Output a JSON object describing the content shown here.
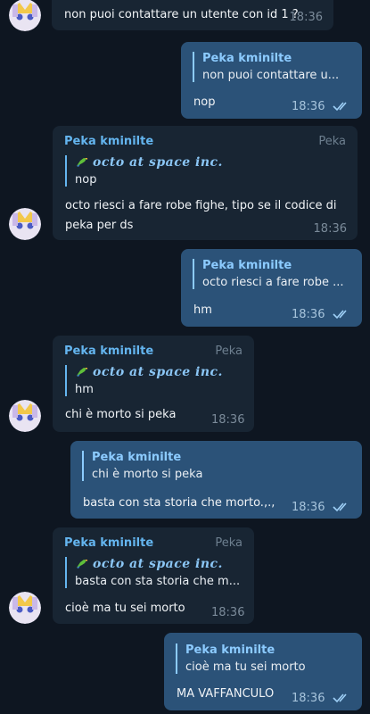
{
  "messages": {
    "m1": {
      "text": "non puoi contattare un utente con id 1 ?",
      "time": "18:36"
    },
    "m2": {
      "quote_name": "Peka kminilte",
      "quote_text": "non puoi contattare u...",
      "text": "nop",
      "time": "18:36"
    },
    "m3": {
      "sender": "Peka kminilte",
      "tag": "Peka",
      "quote_name": "octo at space inc.",
      "quote_text": "nop",
      "text_line1": "octo riesci a fare robe fighe, tipo se il codice di",
      "text_line2": "peka per ds",
      "time": "18:36"
    },
    "m4": {
      "quote_name": "Peka kminilte",
      "quote_text": "octo riesci a fare robe ...",
      "text": "hm",
      "time": "18:36"
    },
    "m5": {
      "sender": "Peka kminilte",
      "tag": "Peka",
      "quote_name": "octo at space inc.",
      "quote_text": "hm",
      "text": "chi è morto si peka",
      "time": "18:36"
    },
    "m6": {
      "quote_name": "Peka kminilte",
      "quote_text": "chi è morto si peka",
      "text": "basta con sta storia che morto.,.,",
      "time": "18:36"
    },
    "m7": {
      "sender": "Peka kminilte",
      "tag": "Peka",
      "quote_name": "octo at space inc.",
      "quote_text": "basta con sta storia che m...",
      "text": "cioè ma tu sei morto",
      "time": "18:36"
    },
    "m8": {
      "quote_name": "Peka kminilte",
      "quote_text": "cioè ma tu sei morto",
      "text": "MA VAFFANCULO",
      "time": "18:36"
    }
  },
  "colors": {
    "background": "#0e1621",
    "incoming_bubble": "#182533",
    "outgoing_bubble": "#2b5278",
    "accent": "#64b5ef"
  },
  "icons": [
    "avatar",
    "parrot-emoji-icon",
    "double-check-icon"
  ]
}
